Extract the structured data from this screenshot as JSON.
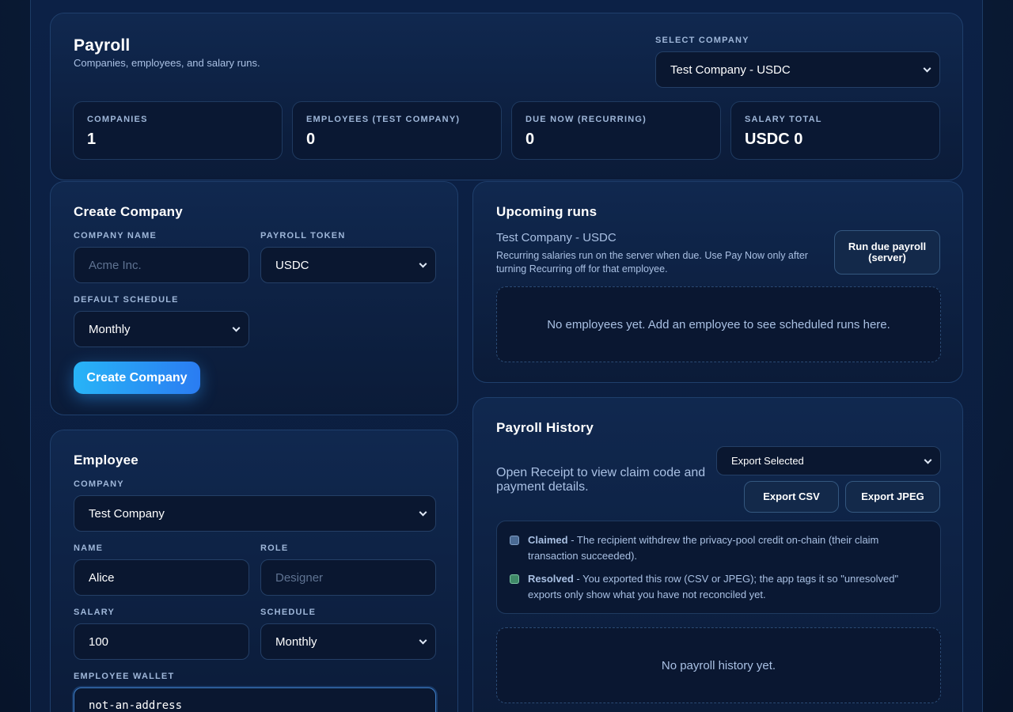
{
  "header": {
    "title": "Payroll",
    "subtitle": "Companies, employees, and salary runs.",
    "select_company_label": "SELECT COMPANY",
    "select_company_value": "Test Company - USDC"
  },
  "stats": [
    {
      "label": "COMPANIES",
      "value": "1"
    },
    {
      "label": "EMPLOYEES (TEST COMPANY)",
      "value": "0"
    },
    {
      "label": "DUE NOW (RECURRING)",
      "value": "0"
    },
    {
      "label": "SALARY TOTAL",
      "value": "USDC 0"
    }
  ],
  "create_company": {
    "title": "Create Company",
    "company_name_label": "COMPANY NAME",
    "company_name_placeholder": "Acme Inc.",
    "payroll_token_label": "PAYROLL TOKEN",
    "payroll_token_value": "USDC",
    "default_schedule_label": "DEFAULT SCHEDULE",
    "default_schedule_value": "Monthly",
    "button": "Create Company"
  },
  "employee": {
    "title": "Employee",
    "company_label": "COMPANY",
    "company_value": "Test Company",
    "name_label": "NAME",
    "name_value": "Alice",
    "role_label": "ROLE",
    "role_placeholder": "Designer",
    "salary_label": "SALARY",
    "salary_value": "100",
    "schedule_label": "SCHEDULE",
    "schedule_value": "Monthly",
    "wallet_label": "EMPLOYEE WALLET",
    "wallet_value": "not-an-address"
  },
  "upcoming": {
    "title": "Upcoming runs",
    "company": "Test Company - USDC",
    "note": "Recurring salaries run on the server when due. Use Pay Now only after turning Recurring off for that employee.",
    "run_button": "Run due payroll (server)",
    "empty": "No employees yet. Add an employee to see scheduled runs here."
  },
  "history": {
    "title": "Payroll History",
    "note": "Open Receipt to view claim code and payment details.",
    "export_select_value": "Export Selected",
    "export_csv": "Export CSV",
    "export_jpeg": "Export JPEG",
    "legend": [
      {
        "term": "Claimed",
        "text": " - The recipient withdrew the privacy-pool credit on-chain (their claim transaction succeeded).",
        "color": "#4a6a94"
      },
      {
        "term": "Resolved",
        "text": " - You exported this row (CSV or JPEG); the app tags it so \"unresolved\" exports only show what you have not reconciled yet.",
        "color": "#3f8a68"
      }
    ],
    "empty": "No payroll history yet."
  }
}
